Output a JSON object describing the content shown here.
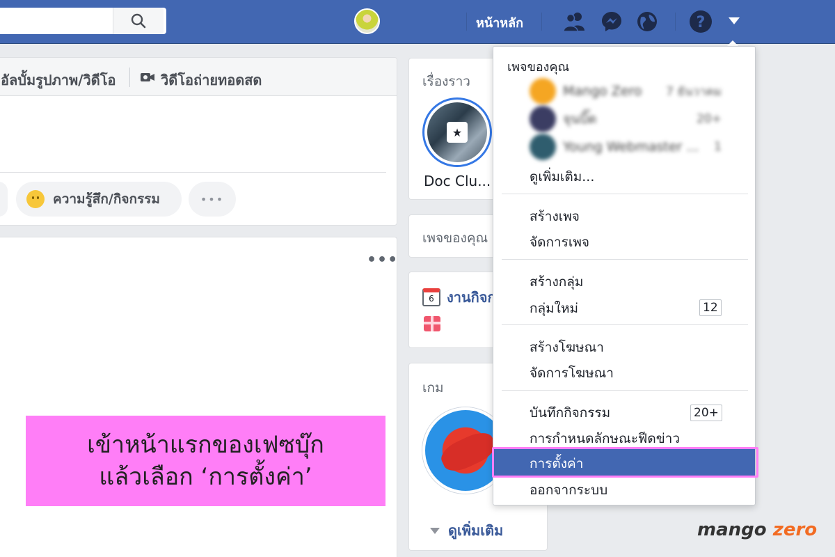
{
  "topbar": {
    "home_label": "หน้าหลัก",
    "icons": [
      "friends-icon",
      "messenger-icon",
      "globe-icon",
      "help-icon",
      "account-caret-icon"
    ],
    "accent_color": "#4267b2"
  },
  "composer": {
    "photo_album_label": "อัลบั้มรูปภาพ/วิดีโอ",
    "live_video_label": "วิดีโอถ่ายทอดสด",
    "feeling_label": "ความรู้สึก/กิจกรรม",
    "more_label": "•••"
  },
  "post": {
    "menu_label": "•••"
  },
  "overlay": {
    "line1": "เข้าหน้าแรกของเฟซบุ๊ก",
    "line2": "แล้วเลือก ‘การตั้งค่า’",
    "color": "#ff7ef7"
  },
  "right_column": {
    "stories_title": "เรื่องราว",
    "story_name": "Doc Clu...",
    "your_pages_title": "เพจของคุณ",
    "events_label": "งานกิจก",
    "events_day": "6",
    "games_title": "เกม",
    "see_more_label": "ดูเพิ่มเติม"
  },
  "menu": {
    "header": "เพจของคุณ",
    "pages": [
      {
        "name": "Mango Zero",
        "meta": "7 ธันวาคม"
      },
      {
        "name": "จุนบิ๊ด",
        "meta": "20+"
      },
      {
        "name": "Young Webmaster ...",
        "meta": "1"
      }
    ],
    "see_more": "ดูเพิ่มเติม...",
    "create_page": "สร้างเพจ",
    "manage_pages": "จัดการเพจ",
    "create_group": "สร้างกลุ่ม",
    "new_groups": "กลุ่มใหม่",
    "new_groups_badge": "12",
    "create_ads": "สร้างโฆษณา",
    "manage_ads": "จัดการโฆษณา",
    "activity_log": "บันทึกกิจกรรม",
    "activity_log_badge": "20+",
    "news_feed_prefs": "การกำหนดลักษณะฟีดข่าว",
    "settings": "การตั้งค่า",
    "logout": "ออกจากระบบ"
  },
  "watermark": {
    "brand": "mango",
    "brand_accent": "zero"
  }
}
